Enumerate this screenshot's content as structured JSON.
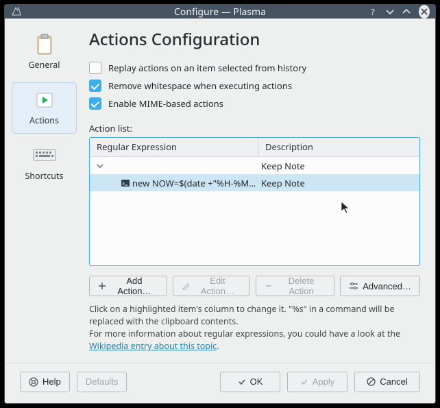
{
  "window": {
    "title": "Configure — Plasma"
  },
  "sidebar": {
    "items": [
      {
        "label": "General"
      },
      {
        "label": "Actions"
      },
      {
        "label": "Shortcuts"
      }
    ],
    "active_index": 1
  },
  "page": {
    "heading": "Actions Configuration",
    "checks": [
      {
        "label": "Replay actions on an item selected from history",
        "checked": false
      },
      {
        "label": "Remove whitespace when executing actions",
        "checked": true
      },
      {
        "label": "Enable MIME-based actions",
        "checked": true
      }
    ],
    "action_list_label": "Action list:",
    "columns": {
      "regex": "Regular Expression",
      "desc": "Description"
    },
    "rows": [
      {
        "regex": "",
        "desc": "Keep Note",
        "level": 0,
        "expanded": true,
        "selected": false
      },
      {
        "regex": "new NOW=$(date +\"%H-%M…",
        "desc": "Keep Note",
        "level": 1,
        "expanded": false,
        "selected": true,
        "icon": "terminal"
      }
    ],
    "buttons": {
      "add": "Add Action…",
      "edit": "Edit Action…",
      "delete": "Delete Action",
      "advanced": "Advanced…"
    },
    "hint_line1": "Click on a highlighted item's column to change it. \"%s\" in a command will be replaced with the clipboard contents.",
    "hint_line2_a": "For more information about regular expressions, you could have a look at the ",
    "hint_link": "Wikipedia entry about this topic",
    "hint_line2_b": "."
  },
  "footer": {
    "help": "Help",
    "defaults": "Defaults",
    "ok": "OK",
    "apply": "Apply",
    "cancel": "Cancel"
  }
}
